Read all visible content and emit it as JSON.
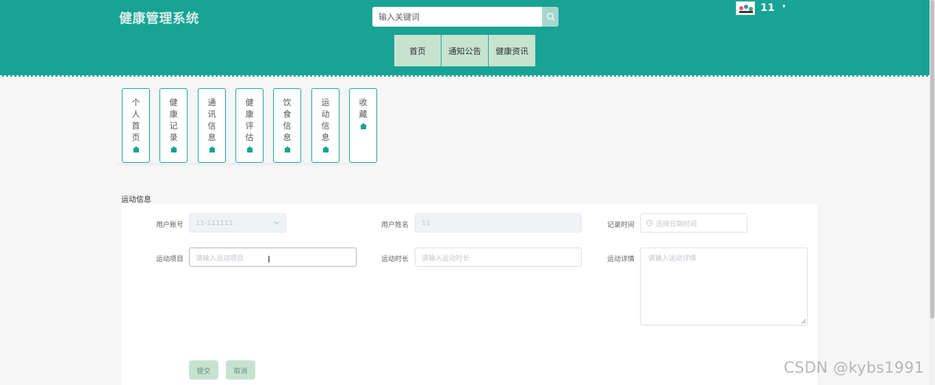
{
  "header": {
    "app_title": "健康管理系统",
    "search_placeholder": "输入关键词",
    "username": "11",
    "user_caret": "▾",
    "bg_color": "#18a394"
  },
  "nav": {
    "items": [
      {
        "label": "首页"
      },
      {
        "label": "通知公告"
      },
      {
        "label": "健康资讯"
      }
    ]
  },
  "side_cards": [
    {
      "label": "个人首页"
    },
    {
      "label": "健康记录"
    },
    {
      "label": "通讯信息"
    },
    {
      "label": "健康评估"
    },
    {
      "label": "饮食信息"
    },
    {
      "label": "运动信息"
    },
    {
      "label": "收藏"
    }
  ],
  "form": {
    "section_title": "运动信息",
    "user_account_label": "用户账号",
    "user_account_value": "11-111111",
    "user_name_label": "用户姓名",
    "user_name_value": "11",
    "record_time_label": "记录时间",
    "record_time_placeholder": "选择日期时间",
    "exercise_item_label": "运动项目",
    "exercise_item_placeholder": "请输入运动项目",
    "exercise_duration_label": "运动时长",
    "exercise_duration_placeholder": "请输入运动时长",
    "exercise_detail_label": "运动详情",
    "exercise_detail_placeholder": "请输入运动详情",
    "submit_label": "提交",
    "cancel_label": "取消"
  },
  "watermark": "CSDN @kybs1991"
}
